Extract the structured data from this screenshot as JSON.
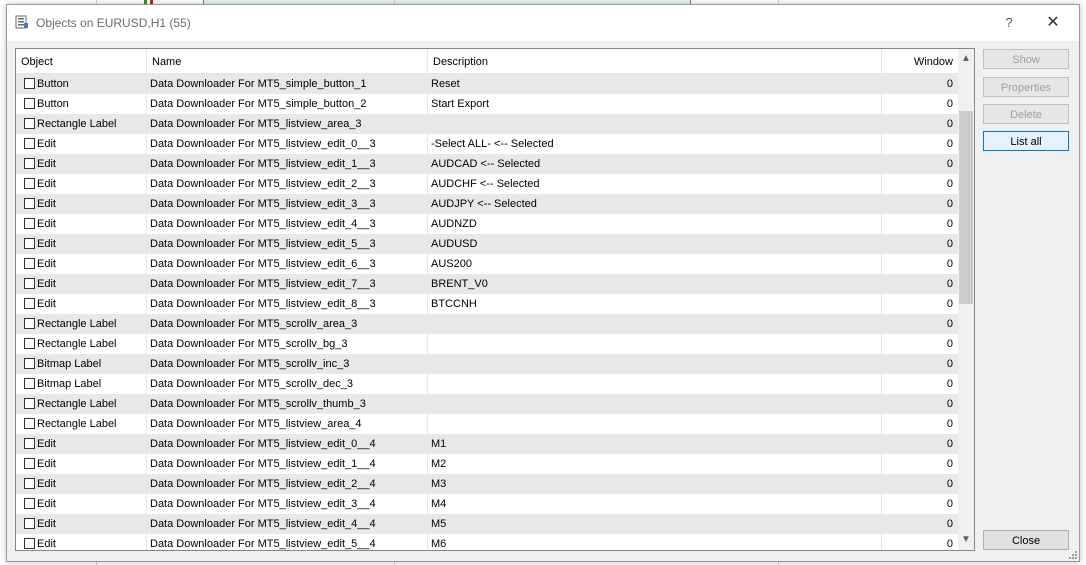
{
  "window": {
    "title": "Objects on EURUSD,H1 (55)",
    "help_glyph": "?",
    "close_glyph": "✕"
  },
  "columns": [
    "Object",
    "Name",
    "Description",
    "Window"
  ],
  "rows": [
    {
      "object": "Button",
      "name": "Data Downloader For MT5_simple_button_1",
      "description": "Reset",
      "window": "0"
    },
    {
      "object": "Button",
      "name": "Data Downloader For MT5_simple_button_2",
      "description": "Start Export",
      "window": "0"
    },
    {
      "object": "Rectangle Label",
      "name": "Data Downloader For MT5_listview_area_3",
      "description": "",
      "window": "0"
    },
    {
      "object": "Edit",
      "name": "Data Downloader For MT5_listview_edit_0__3",
      "description": "-Select ALL-  <-- Selected",
      "window": "0"
    },
    {
      "object": "Edit",
      "name": "Data Downloader For MT5_listview_edit_1__3",
      "description": "AUDCAD  <-- Selected",
      "window": "0"
    },
    {
      "object": "Edit",
      "name": "Data Downloader For MT5_listview_edit_2__3",
      "description": "AUDCHF  <-- Selected",
      "window": "0"
    },
    {
      "object": "Edit",
      "name": "Data Downloader For MT5_listview_edit_3__3",
      "description": "AUDJPY  <-- Selected",
      "window": "0"
    },
    {
      "object": "Edit",
      "name": "Data Downloader For MT5_listview_edit_4__3",
      "description": "AUDNZD",
      "window": "0"
    },
    {
      "object": "Edit",
      "name": "Data Downloader For MT5_listview_edit_5__3",
      "description": "AUDUSD",
      "window": "0"
    },
    {
      "object": "Edit",
      "name": "Data Downloader For MT5_listview_edit_6__3",
      "description": "AUS200",
      "window": "0"
    },
    {
      "object": "Edit",
      "name": "Data Downloader For MT5_listview_edit_7__3",
      "description": "BRENT_V0",
      "window": "0"
    },
    {
      "object": "Edit",
      "name": "Data Downloader For MT5_listview_edit_8__3",
      "description": "BTCCNH",
      "window": "0"
    },
    {
      "object": "Rectangle Label",
      "name": "Data Downloader For MT5_scrollv_area_3",
      "description": "",
      "window": "0"
    },
    {
      "object": "Rectangle Label",
      "name": "Data Downloader For MT5_scrollv_bg_3",
      "description": "",
      "window": "0"
    },
    {
      "object": "Bitmap Label",
      "name": "Data Downloader For MT5_scrollv_inc_3",
      "description": "",
      "window": "0"
    },
    {
      "object": "Bitmap Label",
      "name": "Data Downloader For MT5_scrollv_dec_3",
      "description": "",
      "window": "0"
    },
    {
      "object": "Rectangle Label",
      "name": "Data Downloader For MT5_scrollv_thumb_3",
      "description": "",
      "window": "0"
    },
    {
      "object": "Rectangle Label",
      "name": "Data Downloader For MT5_listview_area_4",
      "description": "",
      "window": "0"
    },
    {
      "object": "Edit",
      "name": "Data Downloader For MT5_listview_edit_0__4",
      "description": "M1",
      "window": "0"
    },
    {
      "object": "Edit",
      "name": "Data Downloader For MT5_listview_edit_1__4",
      "description": "M2",
      "window": "0"
    },
    {
      "object": "Edit",
      "name": "Data Downloader For MT5_listview_edit_2__4",
      "description": "M3",
      "window": "0"
    },
    {
      "object": "Edit",
      "name": "Data Downloader For MT5_listview_edit_3__4",
      "description": "M4",
      "window": "0"
    },
    {
      "object": "Edit",
      "name": "Data Downloader For MT5_listview_edit_4__4",
      "description": "M5",
      "window": "0"
    },
    {
      "object": "Edit",
      "name": "Data Downloader For MT5_listview_edit_5__4",
      "description": "M6",
      "window": "0"
    }
  ],
  "buttons": {
    "show": "Show",
    "properties": "Properties",
    "delete": "Delete",
    "list_all": "List all",
    "close": "Close"
  },
  "scrollbar": {
    "up_glyph": "▲",
    "down_glyph": "▼"
  }
}
